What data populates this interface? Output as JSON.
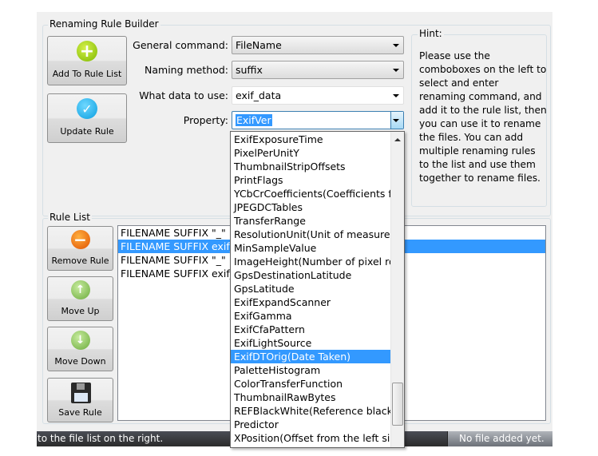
{
  "builder": {
    "title": "Renaming Rule Builder",
    "add_button": "Add To Rule List",
    "update_button": "Update Rule",
    "fields": [
      {
        "label": "General command:",
        "value": "FileName"
      },
      {
        "label": "Naming method:",
        "value": "suffix"
      },
      {
        "label": "What data to use:",
        "value": "exif_data"
      },
      {
        "label": "Property:",
        "value": "ExifVer"
      }
    ]
  },
  "hint": {
    "title": "Hint:",
    "text": "Please use the comboboxes on the left to select and enter renaming command, and add it to the rule list, then you can use it to rename the files. You can add multiple renaming rules to the list and use them together to rename files."
  },
  "rule_list": {
    "title": "Rule List",
    "buttons": {
      "remove": "Remove Rule",
      "move_up": "Move Up",
      "move_down": "Move Down",
      "save": "Save Rule"
    },
    "rows": [
      "FILENAME SUFFIX \"_\"",
      "FILENAME SUFFIX exif_data ExifDTOrig",
      "FILENAME SUFFIX \"_\"",
      "FILENAME SUFFIX exif_data"
    ],
    "selected_index": 1
  },
  "dropdown": {
    "items": [
      "ExifExposureTime",
      "PixelPerUnitY",
      "ThumbnailStripOffsets",
      "PrintFlags",
      "YCbCrCoefficients(Coefficients for",
      "JPEGDCTables",
      "TransferRange",
      "ResolutionUnit(Unit of measure fo",
      "MinSampleValue",
      "ImageHeight(Number of pixel row",
      "GpsDestinationLatitude",
      "GpsLatitude",
      "ExifExpandScanner",
      "ExifGamma",
      "ExifCfaPattern",
      "ExifLightSource",
      "ExifDTOrig(Date Taken)",
      "PaletteHistogram",
      "ColorTransferFunction",
      "ThumbnailRawBytes",
      "REFBlackWhite(Reference black po",
      "Predictor",
      "XPosition(Offset from the left side"
    ],
    "selected_index": 16
  },
  "status": {
    "left": "to the file list on the right.",
    "right": "No file added yet."
  },
  "colors": {
    "selection": "#3399ff",
    "window": "#f0f0f0"
  }
}
